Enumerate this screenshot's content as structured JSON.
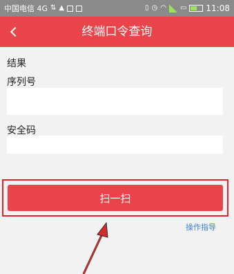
{
  "status_bar": {
    "carrier": "中国电信 4G",
    "time": "11:08"
  },
  "app_bar": {
    "title": "终端口令查询"
  },
  "form": {
    "result_label": "结果",
    "serial_label": "序列号",
    "serial_value": "",
    "security_label": "安全码",
    "security_value": ""
  },
  "actions": {
    "scan_label": "扫一扫",
    "help_label": "操作指导"
  },
  "colors": {
    "accent": "#e8444a",
    "highlight_border": "#e2242a",
    "link": "#3f7fd6",
    "background": "#f2f2f2"
  }
}
